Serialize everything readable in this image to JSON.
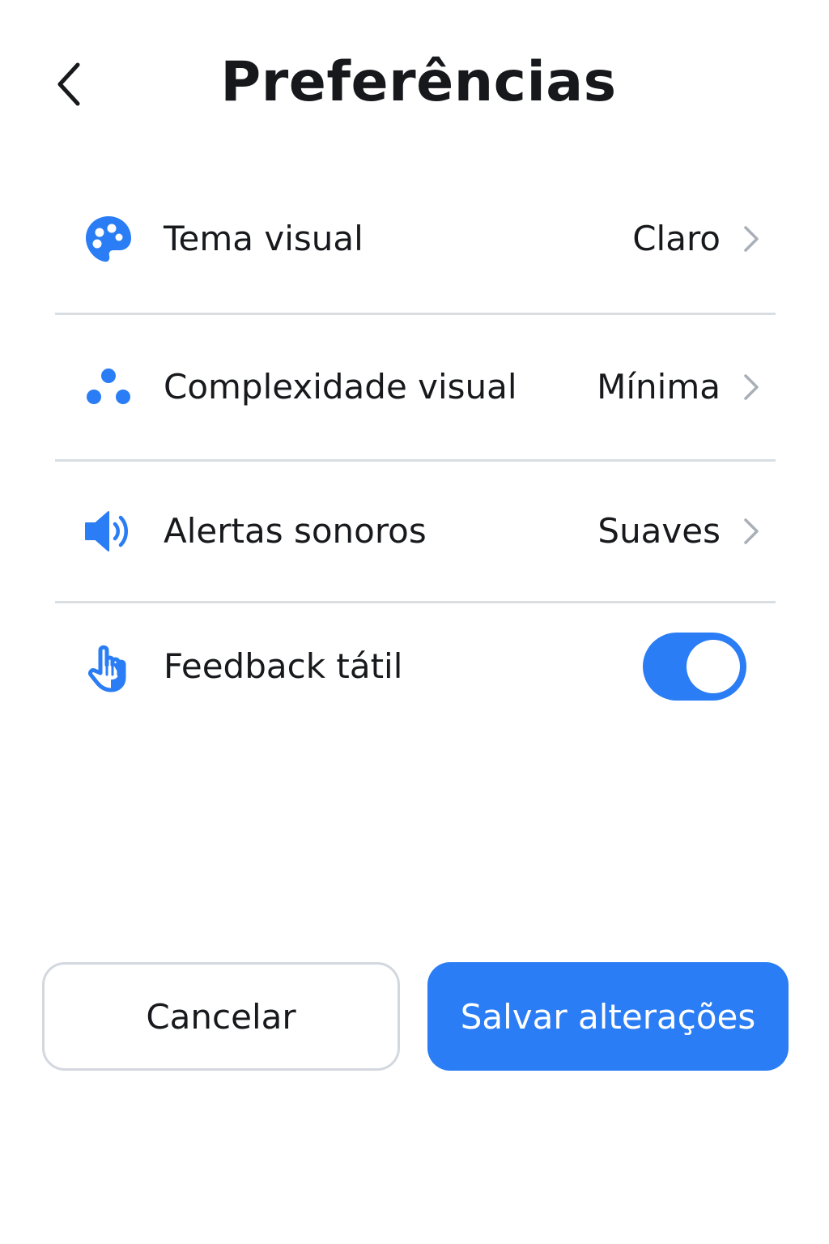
{
  "header": {
    "title": "Preferências",
    "back_icon": "chevron-left-icon"
  },
  "settings": [
    {
      "label": "Tema visual",
      "value": "Claro",
      "icon": "palette-icon"
    },
    {
      "label": "Complexidade visual",
      "value": "Mínima",
      "icon": "dots-icon"
    },
    {
      "label": "Alertas sonoros",
      "value": "Suaves",
      "icon": "speaker-icon"
    },
    {
      "label": "Feedback tátil",
      "value": "on",
      "icon": "hand-icon",
      "control": "toggle"
    }
  ],
  "actions": {
    "cancel_label": "Cancelar",
    "save_label": "Salvar alterações"
  },
  "colors": {
    "accent": "#2a7df4",
    "text": "#17191c",
    "divider": "#d9dee3",
    "chevron": "#a9afb8"
  }
}
